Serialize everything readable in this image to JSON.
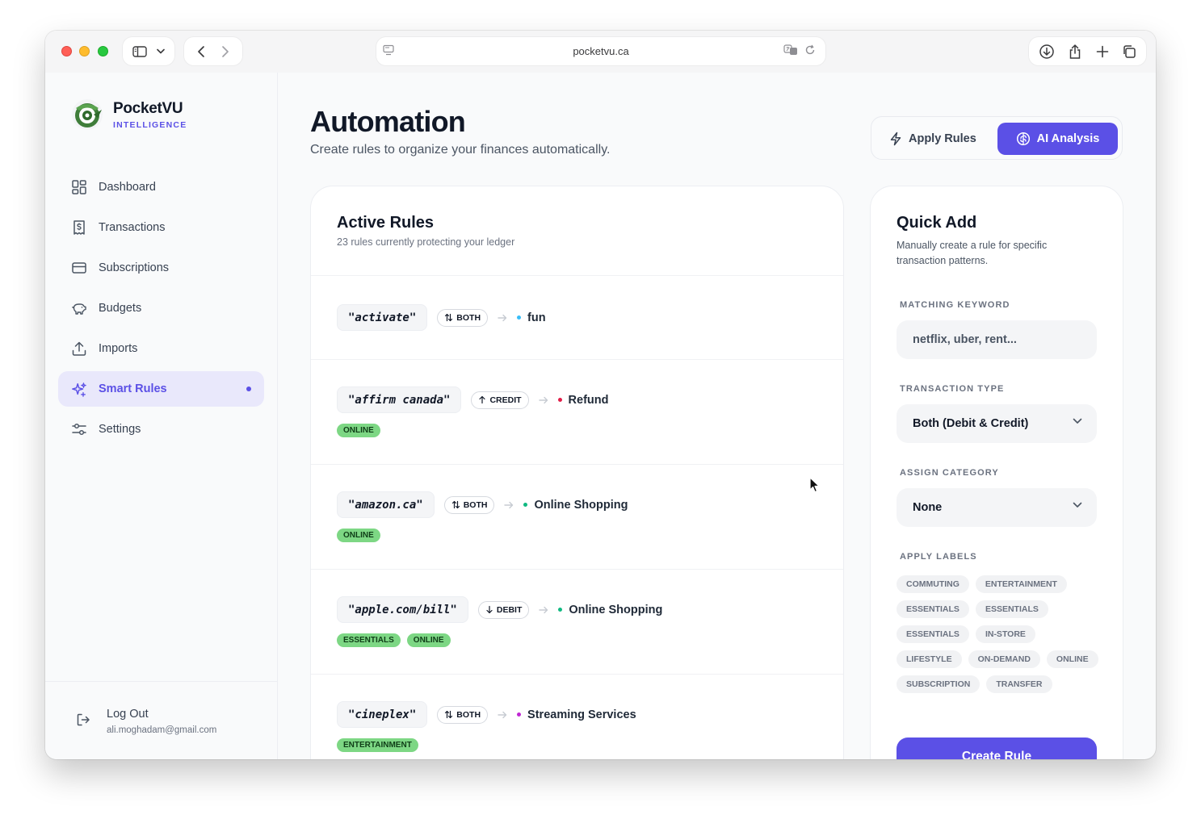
{
  "browser": {
    "url": "pocketvu.ca"
  },
  "brand": {
    "name": "PocketVU",
    "tagline": "INTELLIGENCE"
  },
  "nav": {
    "items": [
      {
        "label": "Dashboard",
        "icon": "dashboard-icon"
      },
      {
        "label": "Transactions",
        "icon": "receipt-icon"
      },
      {
        "label": "Subscriptions",
        "icon": "credit-card-icon"
      },
      {
        "label": "Budgets",
        "icon": "piggy-bank-icon"
      },
      {
        "label": "Imports",
        "icon": "upload-icon"
      },
      {
        "label": "Smart Rules",
        "icon": "sparkles-icon",
        "active": true
      },
      {
        "label": "Settings",
        "icon": "sliders-icon"
      }
    ]
  },
  "user": {
    "logout_label": "Log Out",
    "email": "ali.moghadam@gmail.com"
  },
  "page": {
    "title": "Automation",
    "subtitle": "Create rules to organize your finances automatically.",
    "apply_rules_label": "Apply Rules",
    "ai_analysis_label": "AI Analysis"
  },
  "rules": {
    "title": "Active Rules",
    "subtitle": "23 rules currently protecting your ledger",
    "items": [
      {
        "keyword": "\"activate\"",
        "direction": "BOTH",
        "category": "fun",
        "category_color": "#38bdf8",
        "labels": []
      },
      {
        "keyword": "\"affirm canada\"",
        "direction": "CREDIT",
        "category": "Refund",
        "category_color": "#e11d48",
        "labels": [
          "ONLINE"
        ]
      },
      {
        "keyword": "\"amazon.ca\"",
        "direction": "BOTH",
        "category": "Online Shopping",
        "category_color": "#10b981",
        "labels": [
          "ONLINE"
        ]
      },
      {
        "keyword": "\"apple.com/bill\"",
        "direction": "DEBIT",
        "category": "Online Shopping",
        "category_color": "#10b981",
        "labels": [
          "ESSENTIALS",
          "ONLINE"
        ]
      },
      {
        "keyword": "\"cineplex\"",
        "direction": "BOTH",
        "category": "Streaming Services",
        "category_color": "#c026d3",
        "labels": [
          "ENTERTAINMENT"
        ]
      }
    ]
  },
  "quick_add": {
    "title": "Quick Add",
    "subtitle": "Manually create a rule for specific transaction patterns.",
    "keyword_label": "MATCHING KEYWORD",
    "keyword_placeholder": "netflix, uber, rent...",
    "type_label": "TRANSACTION TYPE",
    "type_value": "Both (Debit & Credit)",
    "category_label": "ASSIGN CATEGORY",
    "category_value": "None",
    "labels_label": "APPLY LABELS",
    "labels": [
      "COMMUTING",
      "ENTERTAINMENT",
      "ESSENTIALS",
      "ESSENTIALS",
      "ESSENTIALS",
      "IN-STORE",
      "LIFESTYLE",
      "ON-DEMAND",
      "ONLINE",
      "SUBSCRIPTION",
      "TRANSFER"
    ],
    "create_label": "Create Rule"
  },
  "colors": {
    "accent": "#5b50e6",
    "label_green": "#7dd784"
  }
}
